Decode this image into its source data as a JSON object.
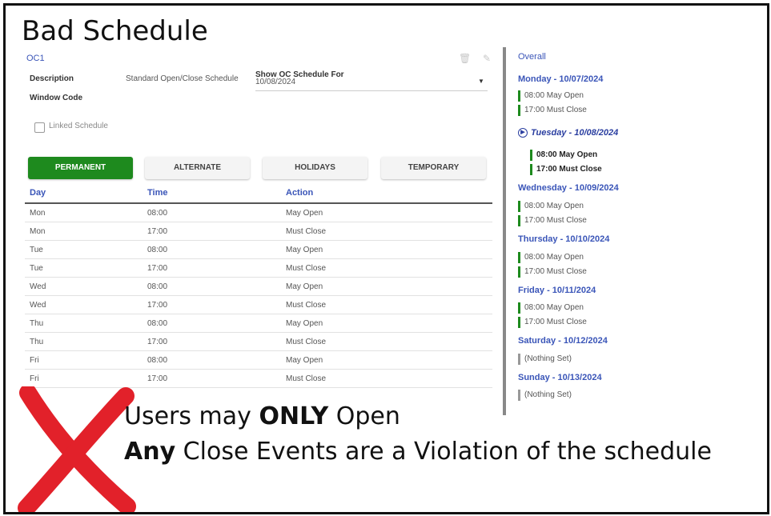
{
  "heading": "Bad Schedule",
  "app": {
    "id": "OC1",
    "description_label": "Description",
    "description_value": "Standard Open/Close Schedule",
    "window_code_label": "Window Code",
    "show_label": "Show OC Schedule For",
    "show_value": "10/08/2024",
    "linked_label": "Linked Schedule",
    "icons": [
      "trash-icon",
      "pencil-icon"
    ]
  },
  "tabs": [
    {
      "label": "PERMANENT",
      "active": true
    },
    {
      "label": "ALTERNATE",
      "active": false
    },
    {
      "label": "HOLIDAYS",
      "active": false
    },
    {
      "label": "TEMPORARY",
      "active": false
    }
  ],
  "table": {
    "headers": [
      "Day",
      "Time",
      "Action"
    ],
    "rows": [
      [
        "Mon",
        "08:00",
        "May Open"
      ],
      [
        "Mon",
        "17:00",
        "Must Close"
      ],
      [
        "Tue",
        "08:00",
        "May Open"
      ],
      [
        "Tue",
        "17:00",
        "Must Close"
      ],
      [
        "Wed",
        "08:00",
        "May Open"
      ],
      [
        "Wed",
        "17:00",
        "Must Close"
      ],
      [
        "Thu",
        "08:00",
        "May Open"
      ],
      [
        "Thu",
        "17:00",
        "Must Close"
      ],
      [
        "Fri",
        "08:00",
        "May Open"
      ],
      [
        "Fri",
        "17:00",
        "Must Close"
      ]
    ]
  },
  "overall": {
    "label": "Overall",
    "days": [
      {
        "heading": "Monday - 10/07/2024",
        "current": false,
        "entries": [
          "08:00 May Open",
          "17:00 Must Close"
        ]
      },
      {
        "heading": "Tuesday - 10/08/2024",
        "current": true,
        "entries": [
          "08:00 May Open",
          "17:00 Must Close"
        ]
      },
      {
        "heading": "Wednesday - 10/09/2024",
        "current": false,
        "entries": [
          "08:00 May Open",
          "17:00 Must Close"
        ]
      },
      {
        "heading": "Thursday - 10/10/2024",
        "current": false,
        "entries": [
          "08:00 May Open",
          "17:00 Must Close"
        ]
      },
      {
        "heading": "Friday - 10/11/2024",
        "current": false,
        "entries": [
          "08:00 May Open",
          "17:00 Must Close"
        ]
      },
      {
        "heading": "Saturday - 10/12/2024",
        "current": false,
        "entries": [
          "(Nothing Set)"
        ]
      },
      {
        "heading": "Sunday - 10/13/2024",
        "current": false,
        "entries": [
          "(Nothing Set)"
        ]
      }
    ]
  },
  "caption": {
    "line1_prefix": "Users may ",
    "line1_bold": "ONLY",
    "line1_suffix": " Open",
    "line2_bold": "Any",
    "line2_suffix": " Close Events are a Violation of the schedule"
  },
  "colors": {
    "accent": "#3a55b8",
    "active_tab": "#1e8a1e",
    "status_bar": "#1e8a1e",
    "empty_bar": "#999999",
    "x_mark": "#e2212a"
  }
}
